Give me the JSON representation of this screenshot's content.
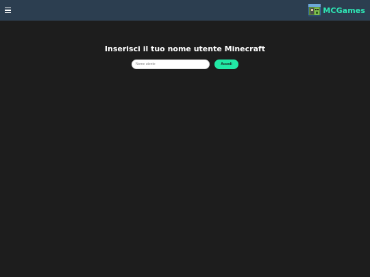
{
  "header": {
    "brand_name": "MCGames",
    "colors": {
      "background": "#2c3e50",
      "brand_text": "#2ee8b6"
    }
  },
  "login": {
    "title": "Inserisci il tuo nome utente Minecraft",
    "username_placeholder": "Nome utente",
    "username_value": "",
    "login_label": "Accedi",
    "colors": {
      "button": "#22e8a5",
      "page_background": "#1d1d1d"
    }
  },
  "icons": {
    "menu": "hamburger-icon",
    "logo": "mcgames-logo"
  }
}
